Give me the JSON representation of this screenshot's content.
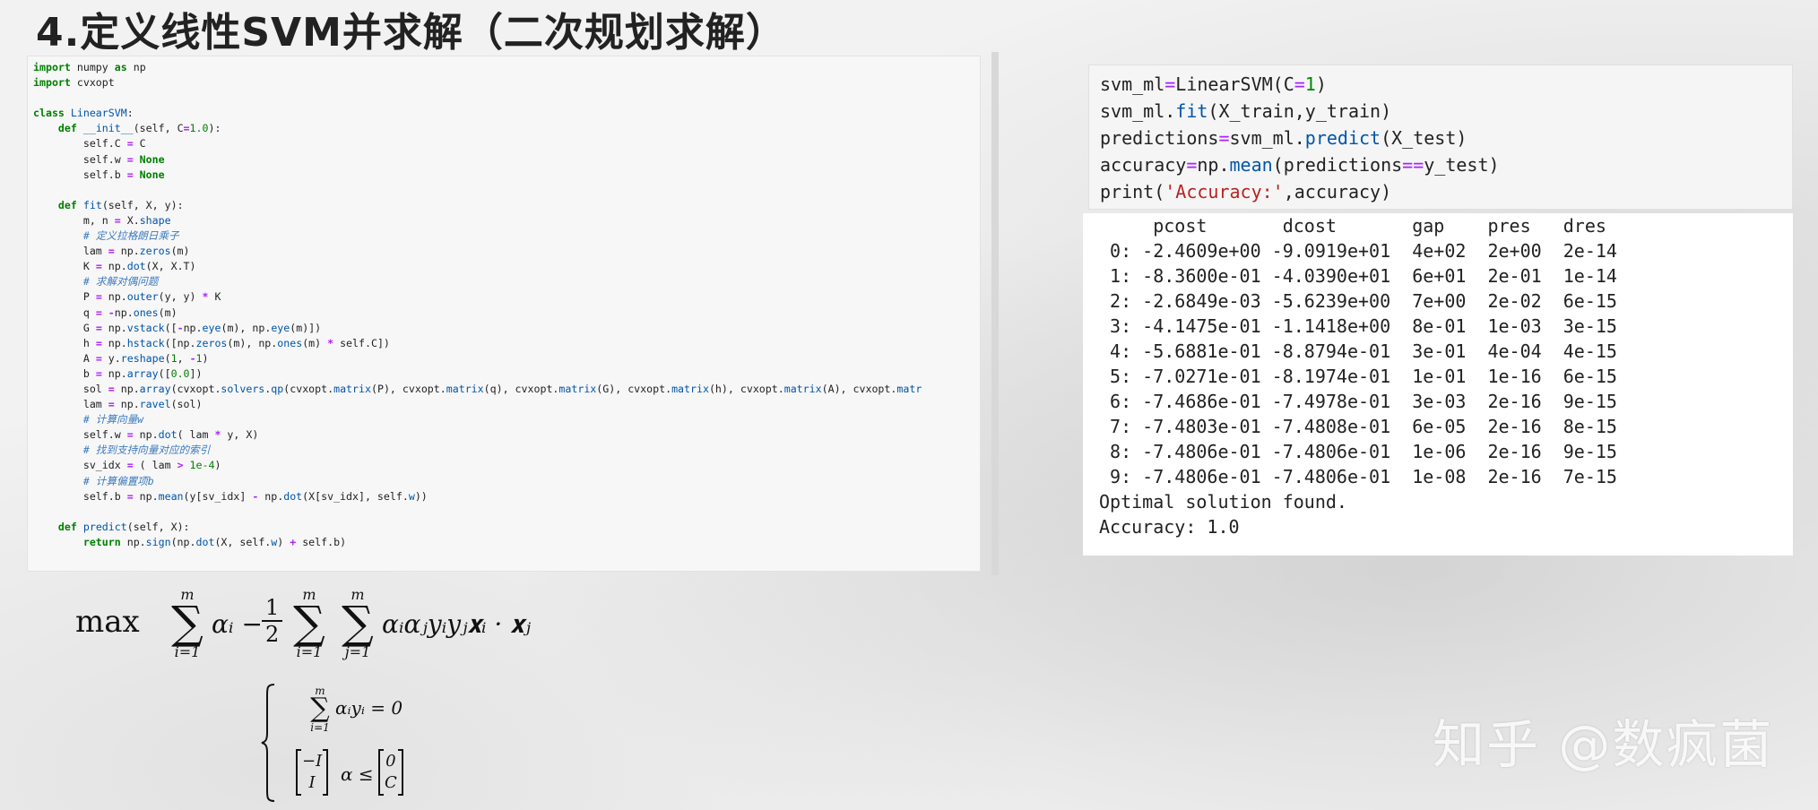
{
  "title": "4.定义线性SVM并求解（二次规划求解）",
  "code_lines": [
    "import numpy as np",
    "import cvxopt",
    "",
    "class LinearSVM:",
    "    def __init__(self, C=1.0):",
    "        self.C = C",
    "        self.w = None",
    "        self.b = None",
    "",
    "    def fit(self, X, y):",
    "        m, n = X.shape",
    "        # 定义拉格朗日乘子",
    "        lam = np.zeros(m)",
    "        K = np.dot(X, X.T)",
    "        # 求解对偶问题",
    "        P = np.outer(y, y) * K",
    "        q = -np.ones(m)",
    "        G = np.vstack([-np.eye(m), np.eye(m)])",
    "        h = np.hstack([np.zeros(m), np.ones(m) * self.C])",
    "        A = y.reshape(1, -1)",
    "        b = np.array([0.0])",
    "        sol = np.array(cvxopt.solvers.qp(cvxopt.matrix(P), cvxopt.matrix(q), cvxopt.matrix(G), cvxopt.matrix(h), cvxopt.matrix(A), cvxopt.matr",
    "        lam = np.ravel(sol)",
    "        # 计算向量w",
    "        self.w = np.dot( lam * y, X)",
    "        # 找到支持向量对应的索引",
    "        sv_idx = ( lam > 1e-4)",
    "        # 计算偏置项b",
    "        self.b = np.mean(y[sv_idx] - np.dot(X[sv_idx], self.w))",
    "",
    "    def predict(self, X):",
    "        return np.sign(np.dot(X, self.w) + self.b)"
  ],
  "cell_lines": [
    "svm_ml=LinearSVM(C=1)",
    "svm_ml.fit(X_train,y_train)",
    "predictions=svm_ml.predict(X_test)",
    "accuracy=np.mean(predictions==y_test)",
    "print('Accuracy:',accuracy)"
  ],
  "output": {
    "header": "     pcost       dcost       gap    pres   dres",
    "rows": [
      " 0: -2.4609e+00 -9.0919e+01  4e+02  2e+00  2e-14",
      " 1: -8.3600e-01 -4.0390e+01  6e+01  2e-01  1e-14",
      " 2: -2.6849e-03 -5.6239e+00  7e+00  2e-02  6e-15",
      " 3: -4.1475e-01 -1.1418e+00  8e-01  1e-03  3e-15",
      " 4: -5.6881e-01 -8.8794e-01  3e-01  4e-04  4e-15",
      " 5: -7.0271e-01 -8.1974e-01  1e-01  1e-16  6e-15",
      " 6: -7.4686e-01 -7.4978e-01  3e-03  2e-16  9e-15",
      " 7: -7.4803e-01 -7.4808e-01  6e-05  2e-16  8e-15",
      " 8: -7.4806e-01 -7.4806e-01  1e-06  2e-16  9e-15",
      " 9: -7.4806e-01 -7.4806e-01  1e-08  2e-16  7e-15"
    ],
    "status": "Optimal solution found.",
    "accuracy": "Accuracy: 1.0"
  },
  "formula": {
    "max": "max",
    "sum_top": "m",
    "sum_bottom_i": "i=1",
    "sum_bottom_j": "j=1",
    "term1": "αᵢ −",
    "half_num": "1",
    "half_den": "2",
    "term2": "αᵢαⱼyᵢyⱼ𝐱ᵢ · 𝐱ⱼ"
  },
  "constraints": {
    "c1_sum_top": "m",
    "c1_sum_bottom": "i=1",
    "c1_expr": "αᵢyᵢ = 0",
    "mat_left_top": "−I",
    "mat_left_bottom": "I",
    "c2_expr": "α ≤",
    "mat_right_top": "0",
    "mat_right_bottom": "C"
  },
  "watermark": "知乎 @数疯菌"
}
